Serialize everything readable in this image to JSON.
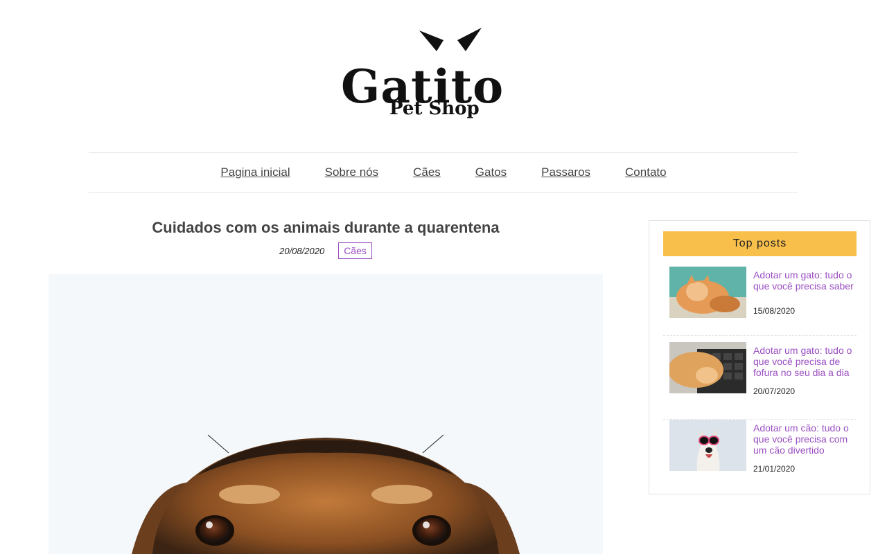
{
  "logo": {
    "title": "Gatito",
    "subtitle": "Pet Shop"
  },
  "nav": [
    {
      "label": "Pagina inicial"
    },
    {
      "label": "Sobre nós"
    },
    {
      "label": "Cães"
    },
    {
      "label": "Gatos"
    },
    {
      "label": "Passaros"
    },
    {
      "label": "Contato"
    }
  ],
  "article": {
    "title": "Cuidados com os animais durante a quarentena",
    "date": "20/08/2020",
    "category": "Cães"
  },
  "sidebar": {
    "heading": "Top posts",
    "posts": [
      {
        "title": "Adotar um gato: tudo o que você precisa saber",
        "date": "15/08/2020"
      },
      {
        "title": "Adotar um gato: tudo o que você precisa de fofura no seu dia a dia",
        "date": "20/07/2020"
      },
      {
        "title": "Adotar um cão: tudo o que você precisa com um cão divertido",
        "date": "21/01/2020"
      }
    ]
  },
  "colors": {
    "accent": "#9b4fc2",
    "highlight": "#f9bf4b"
  }
}
